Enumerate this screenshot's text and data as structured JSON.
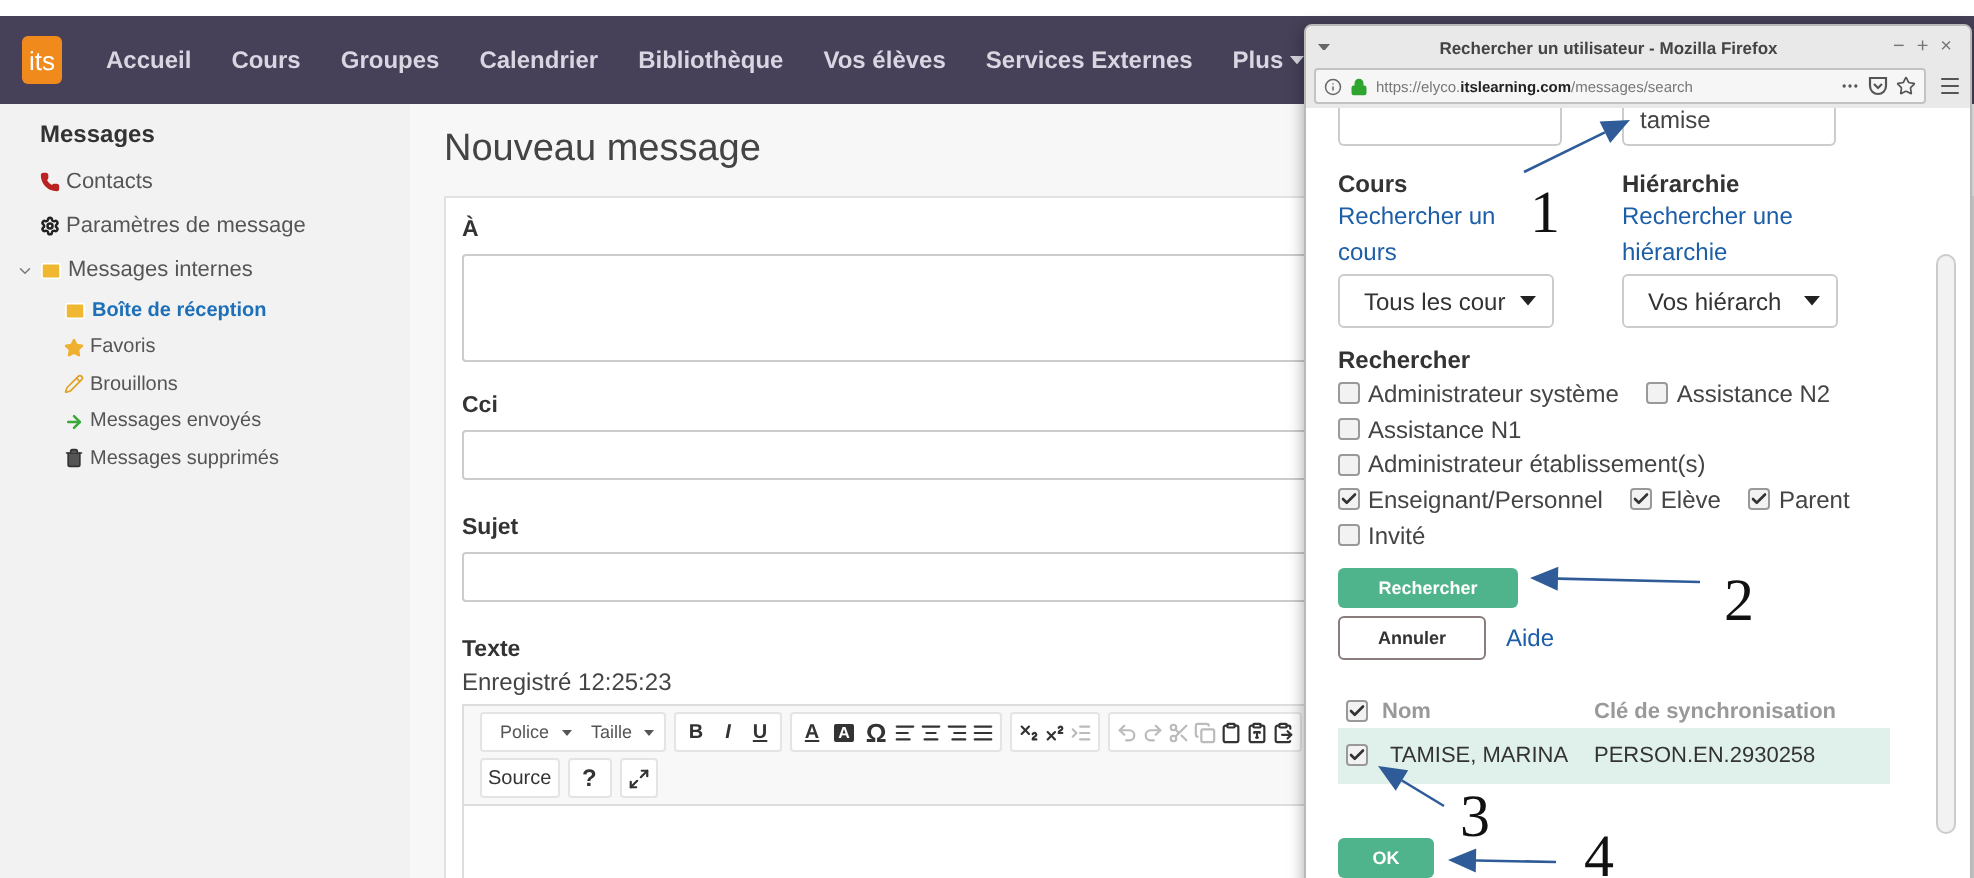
{
  "nav": {
    "logo": "its",
    "items": [
      {
        "label": "Accueil"
      },
      {
        "label": "Cours"
      },
      {
        "label": "Groupes"
      },
      {
        "label": "Calendrier"
      },
      {
        "label": "Bibliothèque"
      },
      {
        "label": "Vos élèves"
      },
      {
        "label": "Services Externes"
      },
      {
        "label": "Plus",
        "dropdown": true
      }
    ]
  },
  "sidebar": {
    "title": "Messages",
    "items": [
      {
        "label": "Contacts",
        "kind": "contacts",
        "selected": false
      },
      {
        "label": "Paramètres de message",
        "kind": "settings",
        "selected": false
      },
      {
        "label": "Messages internes",
        "kind": "folder",
        "selected": false,
        "expanded": true,
        "children": [
          {
            "label": "Boîte de réception",
            "kind": "inbox",
            "selected": true
          },
          {
            "label": "Favoris",
            "kind": "favorites",
            "selected": false
          },
          {
            "label": "Brouillons",
            "kind": "drafts",
            "selected": false
          },
          {
            "label": "Messages envoyés",
            "kind": "sent",
            "selected": false
          },
          {
            "label": "Messages supprimés",
            "kind": "deleted",
            "selected": false
          }
        ]
      }
    ]
  },
  "compose": {
    "title": "Nouveau message",
    "fields": [
      {
        "label": "À",
        "kind": "textarea"
      },
      {
        "label": "Cci",
        "kind": "input"
      },
      {
        "label": "Sujet",
        "kind": "input"
      }
    ],
    "text_label": "Texte",
    "saved": "Enregistré 12:25:23",
    "toolbar": [
      [
        {
          "kind": "dropdown",
          "label": "Police"
        },
        {
          "kind": "dropdown",
          "label": "Taille"
        }
      ],
      [
        {
          "kind": "bold",
          "label": "B"
        },
        {
          "kind": "italic",
          "label": "I"
        },
        {
          "kind": "underline",
          "label": "U"
        }
      ],
      [
        {
          "kind": "text-color",
          "label": "A"
        },
        {
          "kind": "bg-color",
          "label": "A"
        },
        {
          "kind": "symbol",
          "label": "Ω"
        },
        {
          "kind": "align-left"
        },
        {
          "kind": "align-center"
        },
        {
          "kind": "align-right"
        },
        {
          "kind": "align-justify"
        }
      ],
      [
        {
          "kind": "subscript"
        },
        {
          "kind": "superscript"
        },
        {
          "kind": "indent",
          "disabled": true
        }
      ],
      [
        {
          "kind": "undo",
          "disabled": true
        },
        {
          "kind": "redo",
          "disabled": true
        },
        {
          "kind": "cut",
          "disabled": true
        },
        {
          "kind": "copy",
          "disabled": true
        },
        {
          "kind": "paste"
        },
        {
          "kind": "paste-text"
        },
        {
          "kind": "paste-word"
        }
      ],
      [
        {
          "kind": "source",
          "label": "Source"
        }
      ],
      [
        {
          "kind": "help",
          "label": "?"
        }
      ],
      [
        {
          "kind": "maximize"
        }
      ]
    ]
  },
  "popup": {
    "title": "Rechercher un utilisateur - Mozilla Firefox",
    "controls": [
      "−",
      "+",
      "×"
    ],
    "url": "https://elyco.**itslearning.com**/messages/search",
    "search_inputs": [
      {
        "kind": "input"
      },
      {
        "kind": "input",
        "value": "tamise"
      }
    ],
    "filters": [
      {
        "label": "Cours",
        "link": "Rechercher un cours",
        "select": "Tous les cour"
      },
      {
        "label": "Hiérarchie",
        "link": "Rechercher une hiérarchie",
        "select": "Vos hiérarch"
      }
    ],
    "roles_heading": "Rechercher",
    "role_rows": [
      {
        "items": [
          {
            "label": "Administrateur système",
            "checked": false
          },
          {
            "label": "Assistance N2",
            "checked": false
          }
        ]
      },
      {
        "items": [
          {
            "label": "Assistance N1",
            "checked": false
          }
        ]
      },
      {
        "items": [
          {
            "label": "Administrateur établissement(s)",
            "checked": false
          }
        ]
      },
      {
        "items": [
          {
            "label": "Enseignant/Personnel",
            "checked": true
          },
          {
            "label": "Elève",
            "checked": true
          },
          {
            "label": "Parent",
            "checked": true
          }
        ]
      },
      {
        "items": [
          {
            "label": "Invité",
            "checked": false
          }
        ]
      }
    ],
    "search_button": "Rechercher",
    "cancel_button": "Annuler",
    "help_link": "Aide",
    "table": {
      "select_all": true,
      "columns": [
        "Nom",
        "Clé de synchronisation"
      ],
      "rows": [
        {
          "checked": true,
          "selected": true,
          "cells": [
            "TAMISE, MARINA",
            "PERSON.EN.2930258"
          ]
        }
      ]
    },
    "ok_button": "OK"
  },
  "annotations": [
    {
      "label": "1"
    },
    {
      "label": "2"
    },
    {
      "label": "3"
    },
    {
      "label": "4"
    }
  ]
}
